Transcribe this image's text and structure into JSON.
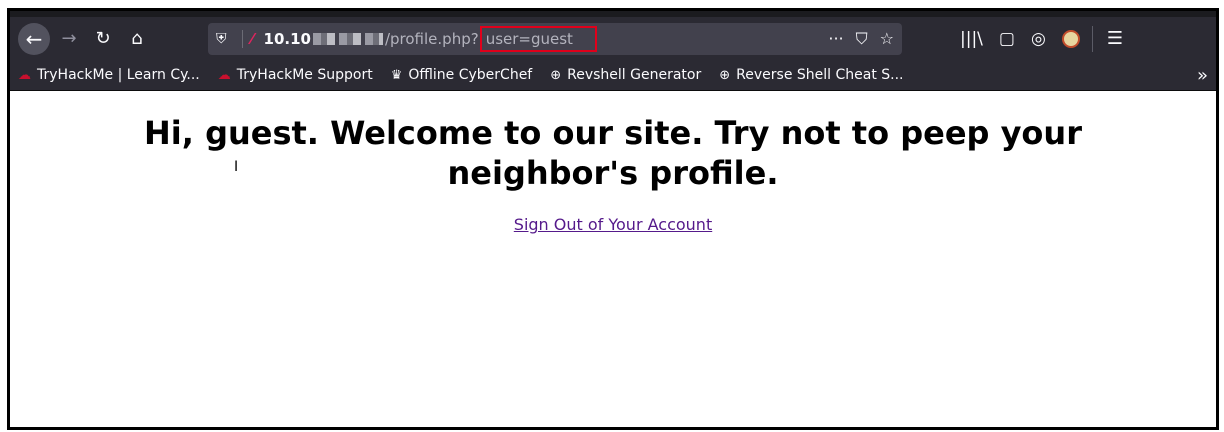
{
  "navbar": {
    "back_icon": "←",
    "forward_icon": "→",
    "reload_icon": "↻",
    "home_icon": "⌂"
  },
  "urlbar": {
    "host": "10.10",
    "path": "/profile.php?",
    "query": "user=guest",
    "more_icon": "···",
    "pocket_icon": "⛉",
    "star_icon": "☆"
  },
  "toolbar": {
    "library_icon": "|||\\",
    "sidebar_icon": "▢",
    "account_icon": "◎",
    "menu_icon": "☰"
  },
  "bookmarks": [
    {
      "label": "TryHackMe | Learn Cy...",
      "icon": "☁"
    },
    {
      "label": "TryHackMe Support",
      "icon": "☁"
    },
    {
      "label": "Offline CyberChef",
      "icon": "♛"
    },
    {
      "label": "Revshell Generator",
      "icon": "⊕"
    },
    {
      "label": "Reverse Shell Cheat S...",
      "icon": "⊕"
    }
  ],
  "bookmarks_overflow": "»",
  "page": {
    "headline": "Hi, guest. Welcome to our site. Try not to peep your neighbor's profile.",
    "signout_link": "Sign Out of Your Account"
  },
  "colors": {
    "chrome_bg": "#2b2a33",
    "urlbar_bg": "#42414d",
    "highlight_box": "#e0001b",
    "visited_link": "#551a8b"
  }
}
